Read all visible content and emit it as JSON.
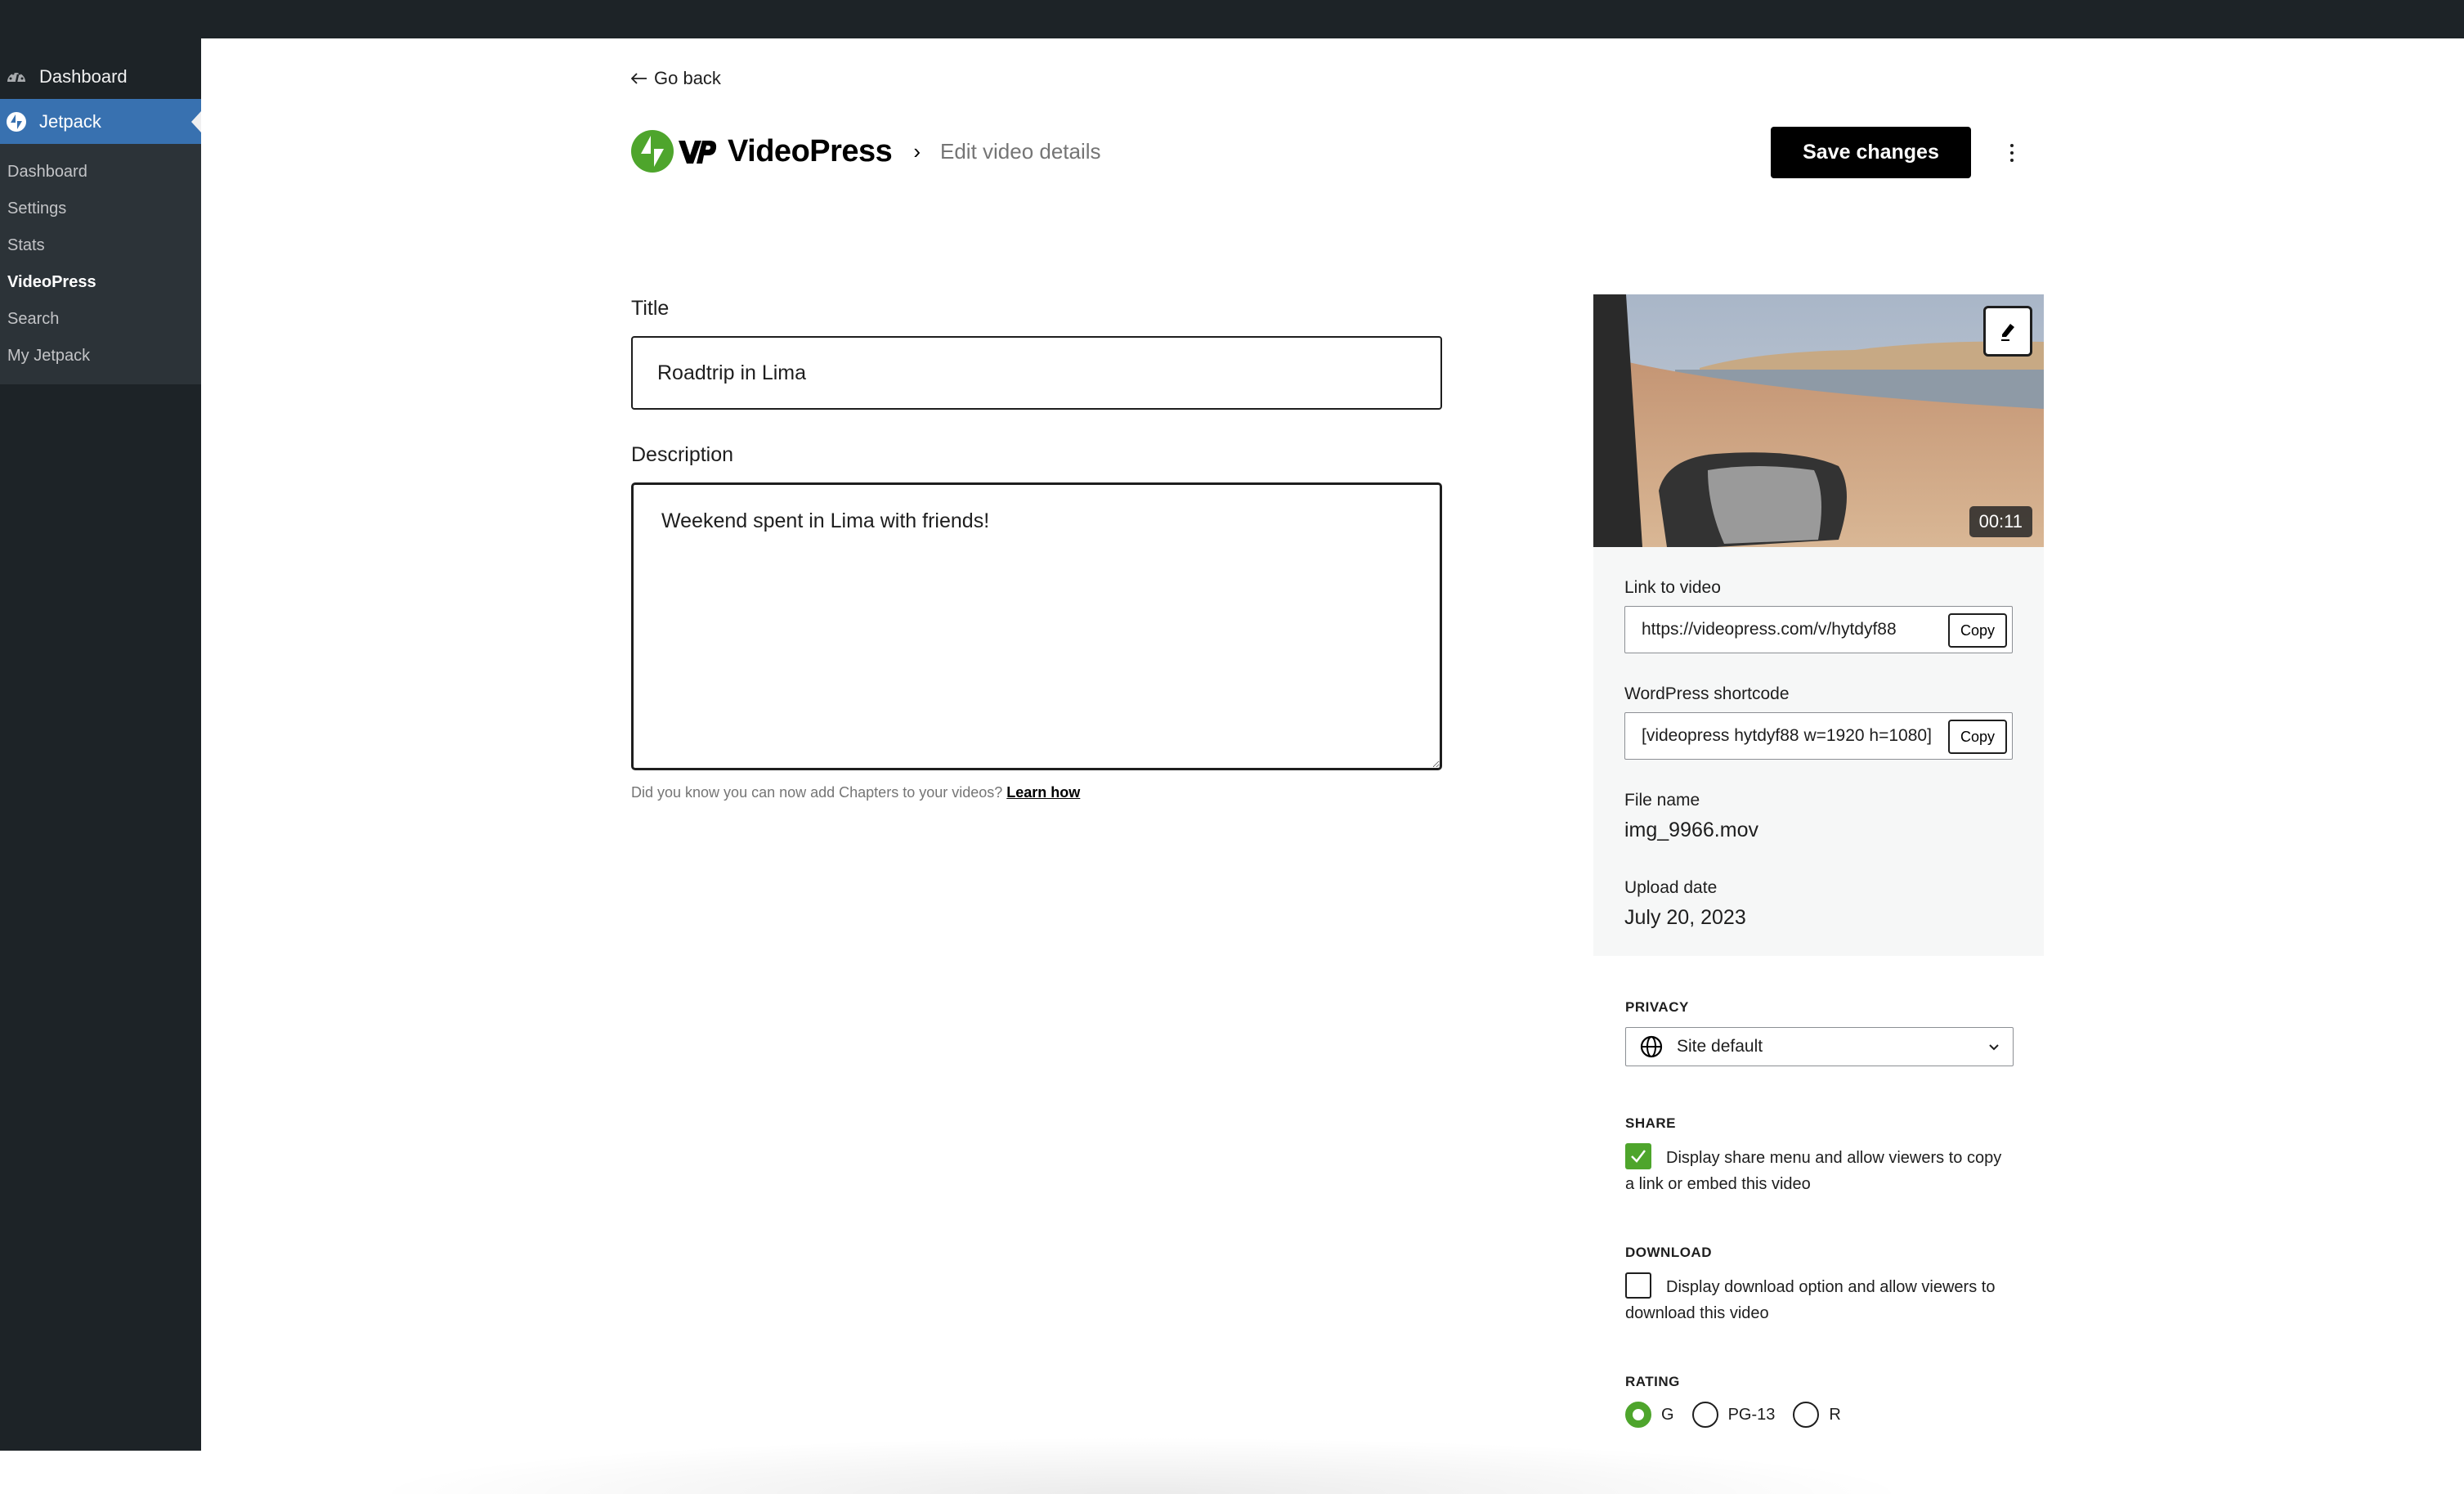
{
  "sidebar": {
    "dashboard_label": "Dashboard",
    "jetpack_label": "Jetpack",
    "submenu": [
      {
        "label": "Dashboard",
        "current": false
      },
      {
        "label": "Settings",
        "current": false
      },
      {
        "label": "Stats",
        "current": false
      },
      {
        "label": "VideoPress",
        "current": true
      },
      {
        "label": "Search",
        "current": false
      },
      {
        "label": "My Jetpack",
        "current": false
      }
    ]
  },
  "header": {
    "go_back": "Go back",
    "brand": "VideoPress",
    "breadcrumb_sep": "›",
    "breadcrumb": "Edit video details",
    "save_label": "Save changes",
    "more_icon": "vertical-ellipsis-icon"
  },
  "form": {
    "title_label": "Title",
    "title_value": "Roadtrip in Lima",
    "description_label": "Description",
    "description_value": "Weekend spent in Lima with friends!",
    "hint_text": "Did you know you can now add Chapters to your videos?",
    "hint_link": "Learn how"
  },
  "video": {
    "duration": "00:11",
    "edit_icon": "pencil-icon",
    "link_label": "Link to video",
    "link_value": "https://videopress.com/v/hytdyf88",
    "shortcode_label": "WordPress shortcode",
    "shortcode_value": "[videopress hytdyf88 w=1920 h=1080]",
    "copy_label": "Copy",
    "file_name_label": "File name",
    "file_name": "img_9966.mov",
    "upload_date_label": "Upload date",
    "upload_date": "July 20, 2023"
  },
  "settings": {
    "privacy_label": "PRIVACY",
    "privacy_value": "Site default",
    "share_label": "SHARE",
    "share_text": "Display share menu and allow viewers to copy a link or embed this video",
    "share_checked": true,
    "download_label": "DOWNLOAD",
    "download_text": "Display download option and allow viewers to download this video",
    "download_checked": false,
    "rating_label": "RATING",
    "rating_options": [
      "G",
      "PG-13",
      "R"
    ],
    "rating_selected": "G"
  },
  "colors": {
    "admin_bar": "#1d2327",
    "menu_active": "#3871b0",
    "accent_green": "#4ea52c",
    "primary_button": "#000000"
  }
}
